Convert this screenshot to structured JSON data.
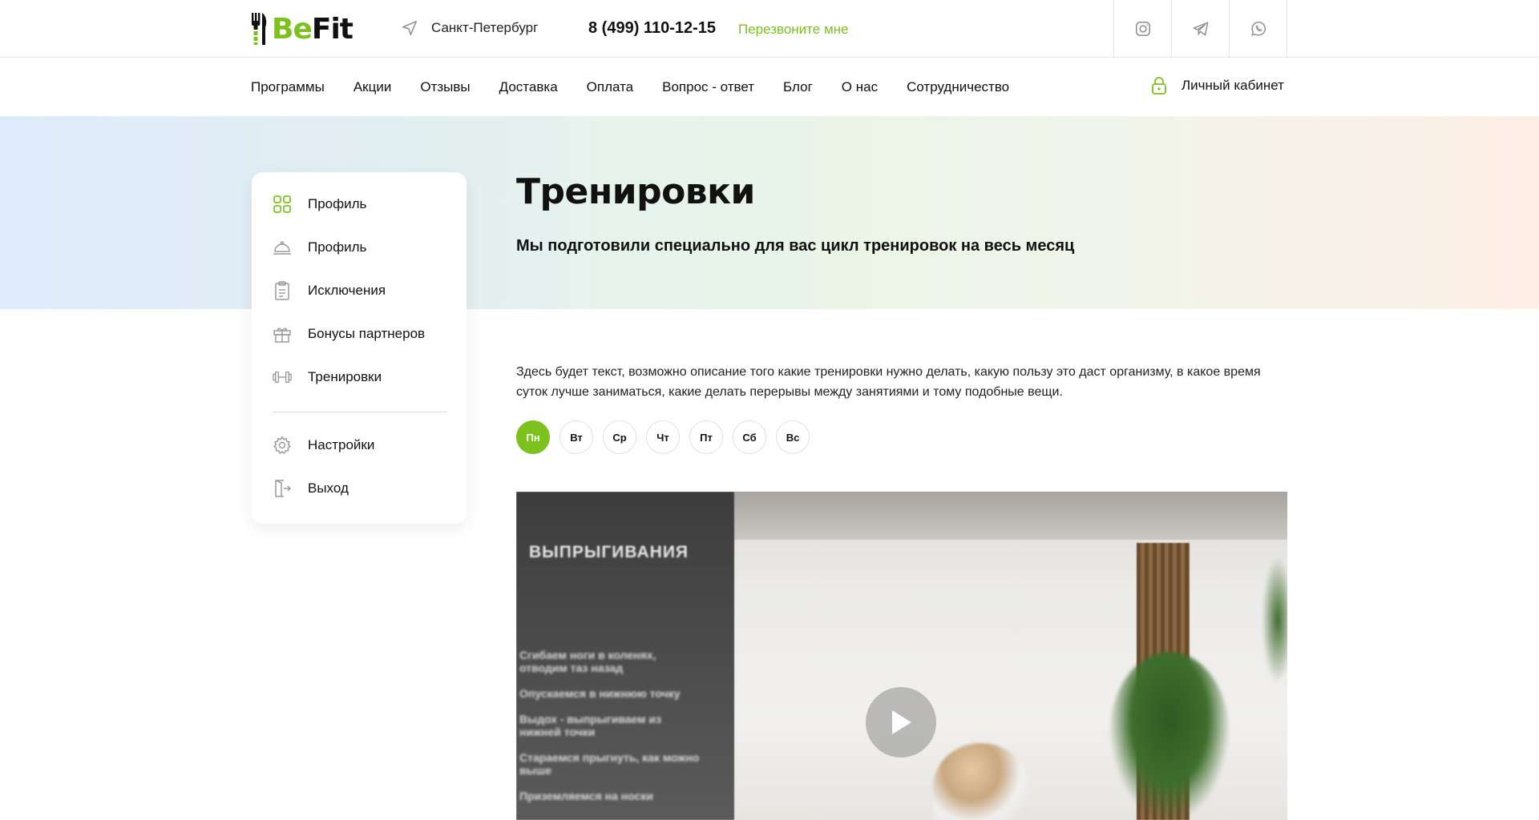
{
  "brand": {
    "logo_be": "Be",
    "logo_fit": "Fit",
    "accent": "#7dc11f"
  },
  "header": {
    "city": "Санкт-Петербург",
    "phone": "8 (499) 110-12-15",
    "callback": "Перезвоните мне",
    "socials": [
      "instagram-icon",
      "telegram-icon",
      "whatsapp-icon"
    ]
  },
  "nav": {
    "items": [
      "Программы",
      "Акции",
      "Отзывы",
      "Доставка",
      "Оплата",
      "Вопрос - ответ",
      "Блог",
      "О нас",
      "Сотрудничество"
    ],
    "cabinet": "Личный кабинет"
  },
  "sidebar": {
    "items": [
      {
        "label": "Профиль",
        "icon": "grid-icon"
      },
      {
        "label": "Профиль",
        "icon": "cloche-icon"
      },
      {
        "label": "Исключения",
        "icon": "clipboard-icon"
      },
      {
        "label": "Бонусы партнеров",
        "icon": "gift-icon"
      },
      {
        "label": "Тренировки",
        "icon": "dumbbell-icon"
      }
    ],
    "bottom": [
      {
        "label": "Настройки",
        "icon": "gear-icon"
      },
      {
        "label": "Выход",
        "icon": "logout-icon"
      }
    ]
  },
  "main": {
    "title": "Тренировки",
    "subtitle": "Мы подготовили специально для вас цикл тренировок на весь месяц",
    "description": "Здесь будет текст, возможно описание того какие тренировки нужно делать, какую пользу это даст организму, в какое время суток лучше заниматься, какие делать перерывы между занятиями и тому подобные вещи.",
    "days": [
      "Пн",
      "Вт",
      "Ср",
      "Чт",
      "Пт",
      "Сб",
      "Вс"
    ],
    "active_day": "Пн"
  },
  "video": {
    "title": "ВЫПРЫГИВАНИЯ",
    "steps": [
      "Сгибаем ноги в коленях, отводим таз назад",
      "Опускаемся в нижнюю точку",
      "Выдох - выпрыгиваем из нижней точки",
      "Стараемся прыгнуть, как можно выше",
      "Приземляемся на носки"
    ]
  }
}
